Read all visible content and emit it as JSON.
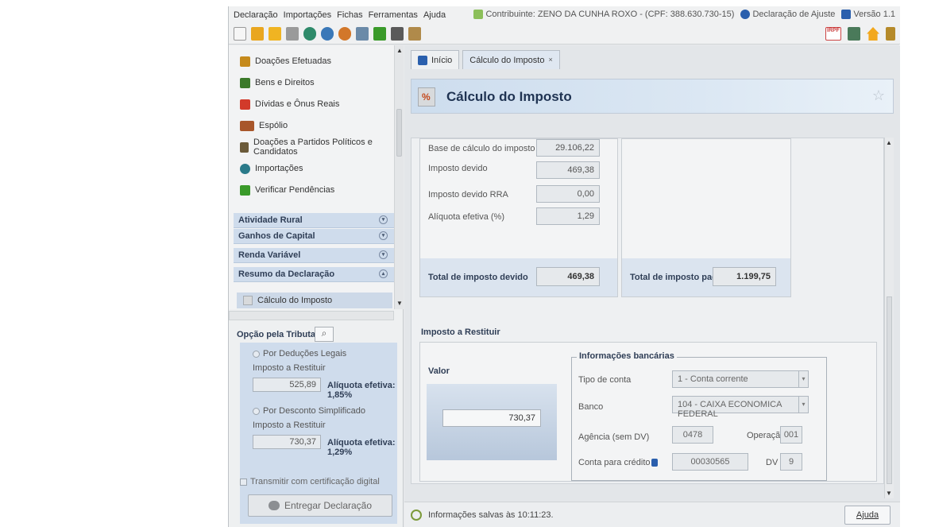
{
  "menu": {
    "items": [
      "Declaração",
      "Importações",
      "Fichas",
      "Ferramentas",
      "Ajuda"
    ],
    "contribuinte": "Contribuinte: ZENO DA CUNHA ROXO - (CPF: 388.630.730-15)",
    "declaracao": "Declaração de Ajuste",
    "versao": "Versão 1.1"
  },
  "toolbar": {
    "icons": [
      "new-icon",
      "open-icon",
      "folder-icon",
      "trash-icon",
      "transmit-icon",
      "receive-icon",
      "globe-icon",
      "print-icon",
      "check-icon",
      "calculator-icon",
      "book-icon"
    ],
    "right_badge": "IRPF"
  },
  "sidebar": {
    "items": [
      {
        "label": "Doações Efetuadas",
        "icon": "doacoes-icon",
        "color": "#c58a1c"
      },
      {
        "label": "Bens e Direitos",
        "icon": "bens-icon",
        "color": "#3b7a2a"
      },
      {
        "label": "Dívidas e Ônus Reais",
        "icon": "dividas-icon",
        "color": "#d23a2a"
      },
      {
        "label": "Espólio",
        "icon": "espolio-icon",
        "color": "#a8562a"
      },
      {
        "label": "Doações a Partidos Políticos e Candidatos",
        "icon": "partidos-icon",
        "color": "#6b5a3a"
      },
      {
        "label": "Importações",
        "icon": "importacoes-icon",
        "color": "#2a7a8a"
      },
      {
        "label": "Verificar Pendências",
        "icon": "check-icon",
        "color": "#3a9a2a"
      }
    ],
    "sections": [
      "Atividade Rural",
      "Ganhos de Capital",
      "Renda Variável",
      "Resumo da Declaração"
    ],
    "selected": "Cálculo do Imposto"
  },
  "opcao": {
    "title": "Opção pela Tributação:",
    "deducoes_label": "Por Deduções Legais",
    "deducoes_sub": "Imposto a Restituir",
    "deducoes_value": "525,89",
    "deducoes_aliq": "Alíquota efetiva: 1,85%",
    "simplificado_label": "Por Desconto Simplificado",
    "simplificado_sub": "Imposto a Restituir",
    "simplificado_value": "730,37",
    "simplificado_aliq": "Alíquota efetiva: 1,29%",
    "transmitir": "Transmitir com certificação digital",
    "entregar": "Entregar Declaração"
  },
  "tabs": [
    "Início",
    "Cálculo do Imposto"
  ],
  "header": {
    "title": "Cálculo do Imposto"
  },
  "calc": {
    "rows": [
      {
        "label": "Base de cálculo do imposto",
        "value": "29.106,22"
      },
      {
        "label": "Imposto devido",
        "value": "469,38"
      },
      {
        "label": "Imposto devido RRA",
        "value": "0,00"
      },
      {
        "label": "Alíquota efetiva (%)",
        "value": "1,29"
      }
    ],
    "total_devido_label": "Total de imposto devido",
    "total_devido_value": "469,38",
    "total_pago_label": "Total de imposto pago",
    "total_pago_value": "1.199,75"
  },
  "restituir": {
    "title": "Imposto a Restituir",
    "valor_label": "Valor",
    "valor": "730,37",
    "bank_title": "Informações bancárias",
    "tipo_label": "Tipo de conta",
    "tipo_value": "1 - Conta corrente",
    "banco_label": "Banco",
    "banco_value": "104 - CAIXA ECONOMICA FEDERAL",
    "agencia_label": "Agência (sem DV)",
    "agencia_value": "0478",
    "operacao_label": "Operação",
    "operacao_value": "001",
    "conta_label": "Conta para crédito",
    "conta_value": "00030565",
    "dv_label": "DV",
    "dv_value": "9"
  },
  "status": {
    "text": "Informações salvas às 10:11:23.",
    "ajuda": "Ajuda"
  }
}
